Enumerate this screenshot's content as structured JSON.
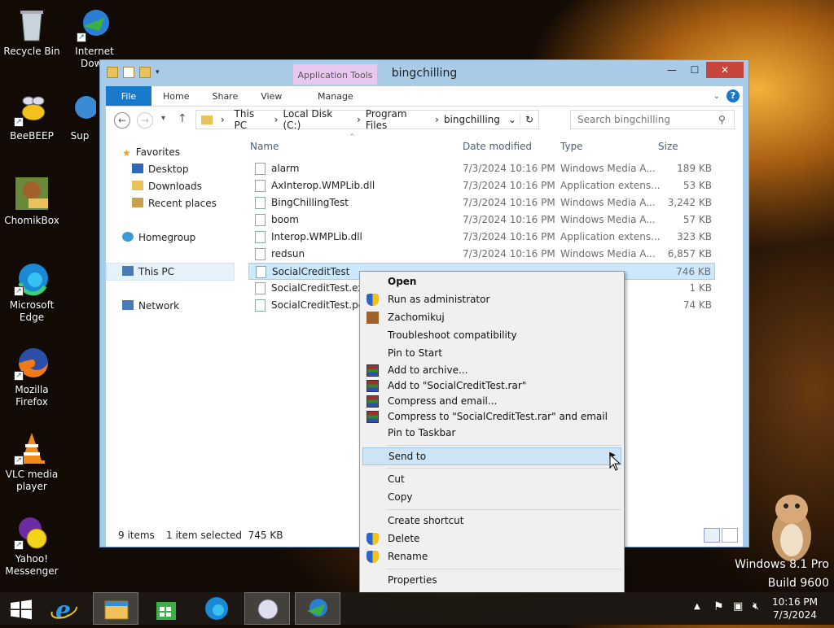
{
  "desktop_icons": [
    {
      "label": "Recycle Bin"
    },
    {
      "label": "Internet Down"
    },
    {
      "label": "BeeBEEP"
    },
    {
      "label": "Sup"
    },
    {
      "label": "ChomikBox"
    },
    {
      "label": "Microsoft Edge"
    },
    {
      "label": "Mozilla Firefox"
    },
    {
      "label": "VLC media player"
    },
    {
      "label": "Yahoo! Messenger"
    }
  ],
  "window": {
    "title": "bingchilling",
    "app_tools": "Application Tools",
    "ribbon": {
      "file": "File",
      "home": "Home",
      "share": "Share",
      "view": "View",
      "manage": "Manage"
    },
    "address": {
      "segments": [
        "This PC",
        "Local Disk (C:)",
        "Program Files",
        "bingchilling"
      ]
    },
    "search_placeholder": "Search bingchilling",
    "nav": {
      "favorites": "Favorites",
      "desktop": "Desktop",
      "downloads": "Downloads",
      "recent": "Recent places",
      "homegroup": "Homegroup",
      "thispc": "This PC",
      "network": "Network"
    },
    "columns": {
      "name": "Name",
      "date": "Date modified",
      "type": "Type",
      "size": "Size"
    },
    "files": [
      {
        "name": "alarm",
        "date": "7/3/2024 10:16 PM",
        "type": "Windows Media A...",
        "size": "189 KB"
      },
      {
        "name": "AxInterop.WMPLib.dll",
        "date": "7/3/2024 10:16 PM",
        "type": "Application extens...",
        "size": "53 KB"
      },
      {
        "name": "BingChillingTest",
        "date": "7/3/2024 10:16 PM",
        "type": "Windows Media A...",
        "size": "3,242 KB"
      },
      {
        "name": "boom",
        "date": "7/3/2024 10:16 PM",
        "type": "Windows Media A...",
        "size": "57 KB"
      },
      {
        "name": "Interop.WMPLib.dll",
        "date": "7/3/2024 10:16 PM",
        "type": "Application extens...",
        "size": "323 KB"
      },
      {
        "name": "redsun",
        "date": "7/3/2024 10:16 PM",
        "type": "Windows Media A...",
        "size": "6,857 KB"
      },
      {
        "name": "SocialCreditTest",
        "date": "",
        "type": "",
        "size": "746 KB"
      },
      {
        "name": "SocialCreditTest.exe.c",
        "date": "",
        "type": "",
        "size": "1 KB"
      },
      {
        "name": "SocialCreditTest.pdb",
        "date": "",
        "type": "",
        "size": "74 KB"
      }
    ],
    "status": {
      "items": "9 items",
      "selected": "1 item selected  745 KB"
    }
  },
  "context_menu": {
    "items": [
      "Open",
      "Run as administrator",
      "Zachomikuj",
      "Troubleshoot compatibility",
      "Pin to Start",
      "Add to archive...",
      "Add to \"SocialCreditTest.rar\"",
      "Compress and email...",
      "Compress to \"SocialCreditTest.rar\" and email",
      "Pin to Taskbar",
      "Send to",
      "Cut",
      "Copy",
      "Create shortcut",
      "Delete",
      "Rename",
      "Properties"
    ]
  },
  "taskbar": {
    "time": "10:16 PM",
    "date": "7/3/2024"
  },
  "watermark": {
    "line1": "Windows 8.1 Pro",
    "line2": "Build 9600"
  }
}
